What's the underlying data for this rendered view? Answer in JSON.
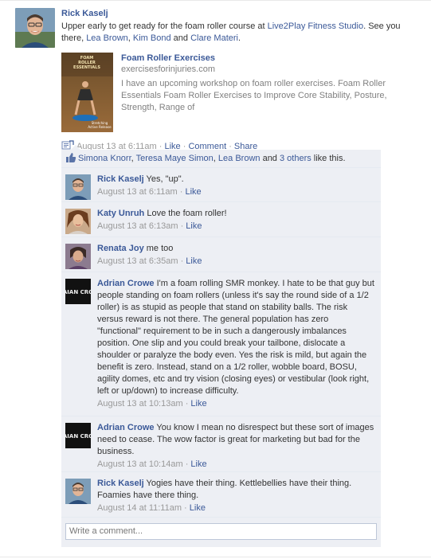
{
  "story": {
    "author": "Rick Kaselj",
    "status_parts": [
      {
        "text": "Upper early to get ready for the foam roller course at ",
        "link": false
      },
      {
        "text": "Live2Play Fitness Studio",
        "link": true
      },
      {
        "text": ". See you there, ",
        "link": false
      },
      {
        "text": "Lea Brown",
        "link": true
      },
      {
        "text": ", ",
        "link": false
      },
      {
        "text": "Kim Bond",
        "link": true
      },
      {
        "text": " and ",
        "link": false
      },
      {
        "text": "Clare Materi",
        "link": true
      },
      {
        "text": ".",
        "link": false
      }
    ],
    "attachment": {
      "thumb_text_top": "FOAM ROLLER ESSENTIALS",
      "thumb_text_bottom": "Stretching Active Release Balance",
      "title": "Foam Roller Exercises",
      "source": "exercisesforinjuries.com",
      "description": "I have an upcoming workshop on foam roller exercises. Foam Roller Essentials Foam Roller Exercises to Improve Core Stability, Posture, Strength, Range of"
    },
    "meta": {
      "time": "August 13 at 6:11am",
      "sep": " · ",
      "like": "Like",
      "comment": "Comment",
      "share": "Share"
    }
  },
  "likes": {
    "names": [
      "Simona Knorr",
      "Teresa Maye Simon",
      "Lea Brown"
    ],
    "sep1": ", ",
    "sep2": ", ",
    "and": " and ",
    "others": "3 others",
    "suffix": " like this."
  },
  "comments": [
    {
      "author": "Rick Kaselj",
      "text": " Yes, \"up\".",
      "time": "August 13 at 6:11am",
      "like": "Like"
    },
    {
      "author": "Katy Unruh",
      "text": " Love the foam roller!",
      "time": "August 13 at 6:13am",
      "like": "Like"
    },
    {
      "author": "Renata Joy",
      "text": " me too",
      "time": "August 13 at 6:35am",
      "like": "Like"
    },
    {
      "author": "Adrian Crowe",
      "text": " I'm a foam rolling SMR monkey. I hate to be that guy but people standing on foam rollers (unless it's say the round side of a 1/2 roller) is as stupid as people that stand on stability balls. The risk versus reward is not there. The general population has zero \"functional\" requirement to be in such a dangerously imbalances position. One slip and you could break your tailbone, dislocate a shoulder or paralyze the body even. Yes the risk is mild, but again the benefit is zero. Instead, stand on a 1/2 roller, wobble board, BOSU, agility domes, etc and try vision (closing eyes) or vestibular (look right, left or up/down) to increase difficulty.",
      "time": "August 13 at 10:13am",
      "like": "Like"
    },
    {
      "author": "Adrian Crowe",
      "text": " You know I mean no disrespect but these sort of images need to cease. The wow factor is great for marketing but bad for the business.",
      "time": "August 13 at 10:14am",
      "like": "Like"
    },
    {
      "author": "Rick Kaselj",
      "text": " Yogies have their thing. Kettlebellies have their thing. Foamies have there thing.",
      "time": "August 14 at 11:11am",
      "like": "Like"
    }
  ],
  "write_comment": {
    "placeholder": "Write a comment..."
  },
  "meta_sep": " · ",
  "avatar_text": "AIAN CRO",
  "colors": {
    "link": "#3b5998",
    "feedback_bg": "#edeff4",
    "muted": "#999999"
  }
}
